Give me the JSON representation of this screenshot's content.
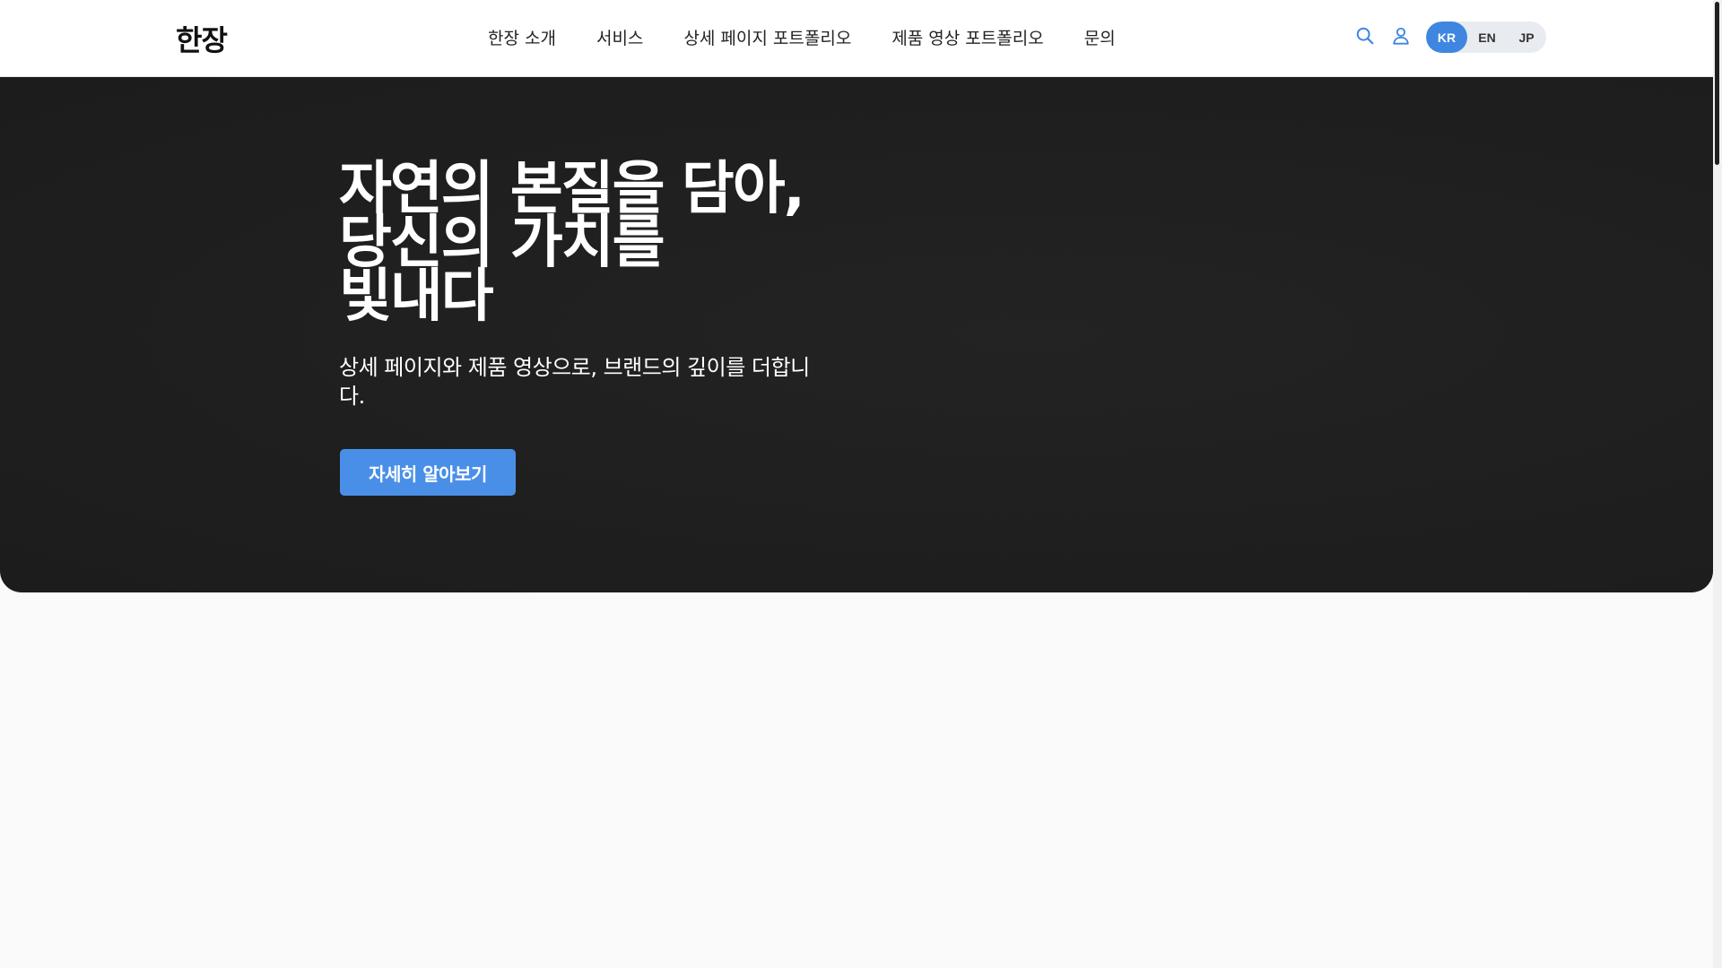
{
  "header": {
    "logo": "한장",
    "nav": [
      {
        "label": "한장 소개"
      },
      {
        "label": "서비스"
      },
      {
        "label": "상세 페이지 포트폴리오"
      },
      {
        "label": "제품 영상 포트폴리오"
      },
      {
        "label": "문의"
      }
    ],
    "icons": {
      "search": "search-icon",
      "user": "user-icon"
    },
    "languages": [
      {
        "code": "KR",
        "active": true
      },
      {
        "code": "EN",
        "active": false
      },
      {
        "code": "JP",
        "active": false
      }
    ]
  },
  "hero": {
    "title": "자연의 본질을 담아, 당신의 가치를 빛내다",
    "subtitle": "상세 페이지와 제품 영상으로, 브랜드의 깊이를 더합니다.",
    "cta_label": "자세히 알아보기"
  },
  "colors": {
    "accent": "#4a8fe7",
    "hero_background": "#1f1f1f",
    "page_background": "#fafafa",
    "header_background": "#ffffff"
  }
}
